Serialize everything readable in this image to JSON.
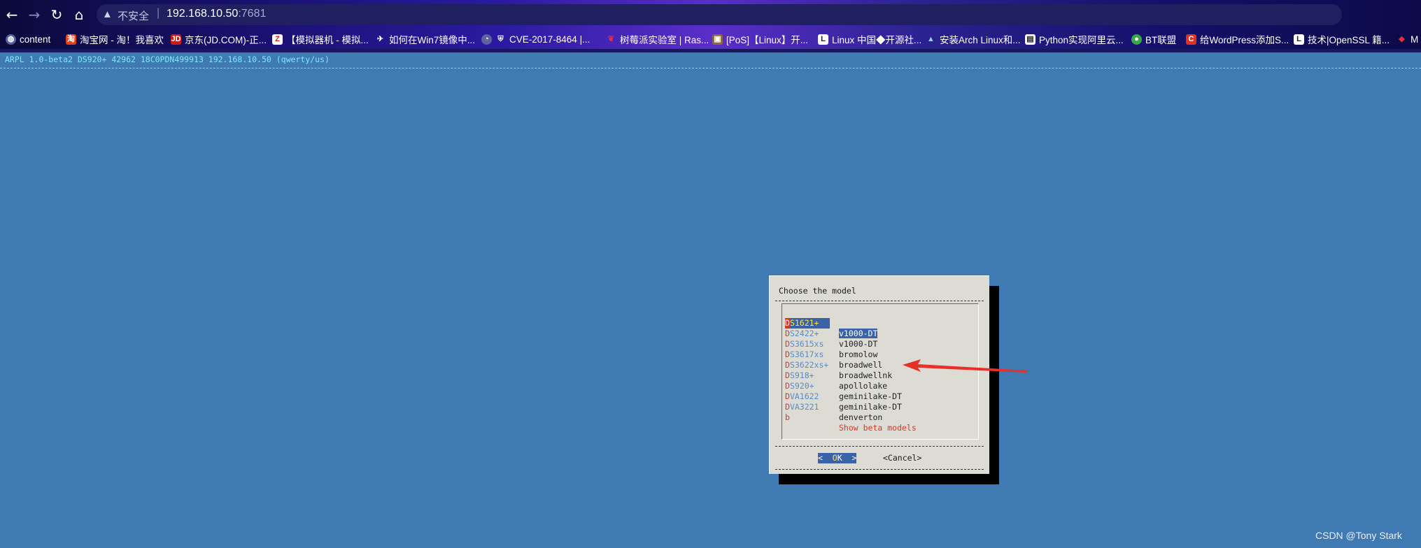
{
  "browser": {
    "security_label": "不安全",
    "separator": "|",
    "url_host": "192.168.10.50",
    "url_port": ":7681",
    "bookmarks": [
      {
        "label": "content",
        "icon": "globe-icon"
      },
      {
        "label": "淘宝网 - 淘！我喜欢",
        "icon": "taobao-icon"
      },
      {
        "label": "京东(JD.COM)-正...",
        "icon": "jd-icon"
      },
      {
        "label": "【模拟器机 - 模拟...",
        "icon": "z-icon"
      },
      {
        "label": "如何在Win7镜像中...",
        "icon": "bird-icon"
      },
      {
        "label": "CVE-2017-8464 |...",
        "icon": "shield-icon"
      },
      {
        "label": "树莓派实验室 | Ras...",
        "icon": "raspberry-icon"
      },
      {
        "label": "[PoS]【Linux】开...",
        "icon": "box-icon"
      },
      {
        "label": "Linux 中国◆开源社...",
        "icon": "linux-icon"
      },
      {
        "label": "安装Arch Linux和...",
        "icon": "arch-icon"
      },
      {
        "label": "Python实现阿里云...",
        "icon": "page-icon"
      },
      {
        "label": "BT联盟",
        "icon": "bt-icon"
      },
      {
        "label": "给WordPress添加S...",
        "icon": "c-icon"
      },
      {
        "label": "技术|OpenSSL 籍...",
        "icon": "linux-icon"
      },
      {
        "label": "M",
        "icon": "leaf-icon"
      }
    ]
  },
  "terminal": {
    "header": "ARPL 1.0-beta2 DS920+ 42962 18C0PDN499913 192.168.10.50 (qwerty/us)"
  },
  "dialog": {
    "title": "Choose the model",
    "items": [
      {
        "tag_first": "D",
        "tag_rest": "S1621+",
        "item": "v1000-DT",
        "selected": true
      },
      {
        "tag_first": "D",
        "tag_rest": "S2422+",
        "item": "v1000-DT"
      },
      {
        "tag_first": "D",
        "tag_rest": "S3615xs",
        "item": "bromolow"
      },
      {
        "tag_first": "D",
        "tag_rest": "S3617xs",
        "item": "broadwell"
      },
      {
        "tag_first": "D",
        "tag_rest": "S3622xs+",
        "item": "broadwellnk"
      },
      {
        "tag_first": "D",
        "tag_rest": "S918+",
        "item": "apollolake"
      },
      {
        "tag_first": "D",
        "tag_rest": "S920+",
        "item": "geminilake-DT"
      },
      {
        "tag_first": "D",
        "tag_rest": "VA1622",
        "item": "geminilake-DT"
      },
      {
        "tag_first": "D",
        "tag_rest": "VA3221",
        "item": "denverton"
      },
      {
        "tag_first": "b",
        "tag_rest": "",
        "item": "Show beta models",
        "beta": true
      }
    ],
    "ok_left": "<  ",
    "ok_hot": "O",
    "ok_right": "K  >",
    "cancel": "<Cancel>"
  },
  "watermark": "CSDN @Tony Stark",
  "colors": {
    "terminal_bg": "#3f7ab3",
    "dialog_bg": "#dcdcd4",
    "selection": "#3a62a8",
    "hotkey": "#d03a2a",
    "arrow": "#e8302a"
  }
}
